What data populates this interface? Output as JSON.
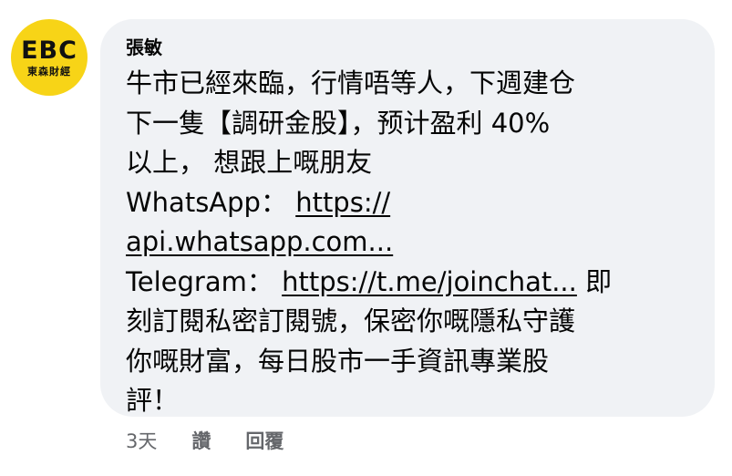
{
  "avatar": {
    "logo_text": "EBC",
    "sub_text": "東森財經",
    "color": "#f7d417"
  },
  "comment": {
    "author": "張敏",
    "lines": {
      "l1": "牛市已經來臨，行情唔等人，下週建仓",
      "l2": "下一隻【調研金股】，预计盈利 40%",
      "l3": "以上， 想跟上嘅朋友",
      "l4_label": "WhatsApp： ",
      "l4_link": "https://",
      "l5_link": "api.whatsapp.com...",
      "l6_label": "Telegram： ",
      "l6_link": "https://t.me/joinchat...",
      "l6_tail": " 即",
      "l7": "刻訂閱私密訂閱號，保密你嘅隱私守護",
      "l8": "你嘅財富，每日股市一手資訊專業股",
      "l9": "評！"
    }
  },
  "actions": {
    "time": "3天",
    "like": "讚",
    "reply": "回覆"
  },
  "colors": {
    "bubble": "#f0f2f5",
    "text": "#050505",
    "meta": "#65676b"
  }
}
